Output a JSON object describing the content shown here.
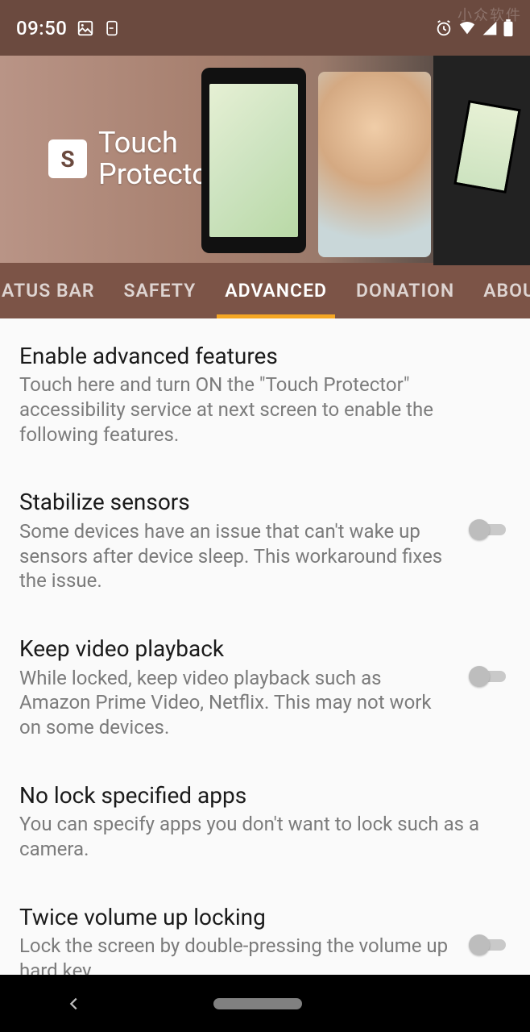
{
  "status": {
    "time": "09:50",
    "watermark": "小众软件"
  },
  "app": {
    "title_line1": "Touch",
    "title_line2": "Protector",
    "logo_letter": "S"
  },
  "tabs": [
    {
      "label": "ATUS BAR",
      "active": false
    },
    {
      "label": "SAFETY",
      "active": false
    },
    {
      "label": "ADVANCED",
      "active": true
    },
    {
      "label": "DONATION",
      "active": false
    },
    {
      "label": "ABOUT",
      "active": false
    }
  ],
  "settings": [
    {
      "title": "Enable advanced features",
      "desc": "Touch here and turn ON the \"Touch Protector\" accessibility service at next screen to enable the following features.",
      "has_switch": false
    },
    {
      "title": "Stabilize sensors",
      "desc": "Some devices have an issue that can't wake up sensors after device sleep. This workaround fixes the issue.",
      "has_switch": true,
      "switch_on": false
    },
    {
      "title": "Keep video playback",
      "desc": "While locked, keep video playback such as Amazon Prime Video, Netflix. This may not work on some devices.",
      "has_switch": true,
      "switch_on": false
    },
    {
      "title": "No lock specified apps",
      "desc": "You can specify apps you don't want to lock such as a camera.",
      "has_switch": false
    },
    {
      "title": "Twice volume up locking",
      "desc": "Lock the screen by double-pressing the volume up hard key.",
      "has_switch": true,
      "switch_on": false
    }
  ]
}
